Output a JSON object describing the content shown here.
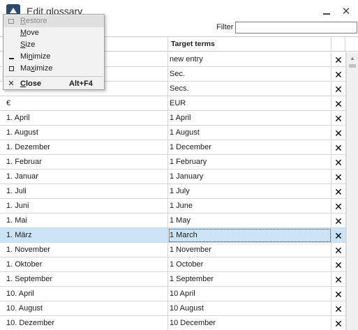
{
  "window": {
    "title": "Edit glossary",
    "close_glyph": "✕",
    "icon": "app-logo-icon"
  },
  "filter": {
    "label": "Filter",
    "value": "",
    "placeholder": ""
  },
  "table": {
    "headers": {
      "source": "",
      "target": "Target terms",
      "delete": ""
    },
    "delete_glyph": "✕",
    "rows": [
      {
        "source": "",
        "target": "new entry"
      },
      {
        "source": "",
        "target": "Sec."
      },
      {
        "source": "",
        "target": "Secs."
      },
      {
        "source": "€",
        "target": "EUR"
      },
      {
        "source": "1. April",
        "target": "1 April"
      },
      {
        "source": "1. August",
        "target": "1 August"
      },
      {
        "source": "1. Dezember",
        "target": "1 December"
      },
      {
        "source": "1. Februar",
        "target": "1 February"
      },
      {
        "source": "1. Januar",
        "target": "1 January"
      },
      {
        "source": "1. Juli",
        "target": "1 July"
      },
      {
        "source": "1. Juni",
        "target": "1 June"
      },
      {
        "source": "1. Mai",
        "target": "1 May"
      },
      {
        "source": "1. März",
        "target": "1 March",
        "selected": true
      },
      {
        "source": "1. November",
        "target": "1 November"
      },
      {
        "source": "1. Oktober",
        "target": "1 October"
      },
      {
        "source": "1. September",
        "target": "1 September"
      },
      {
        "source": "10. April",
        "target": "10 April"
      },
      {
        "source": "10. August",
        "target": "10 August"
      },
      {
        "source": "10. Dezember",
        "target": "10 December"
      }
    ]
  },
  "system_menu": {
    "items": [
      {
        "id": "restore",
        "pre": "",
        "ul": "R",
        "post": "estore",
        "accel": "",
        "disabled": true
      },
      {
        "id": "move",
        "pre": "",
        "ul": "M",
        "post": "ove",
        "accel": ""
      },
      {
        "id": "size",
        "pre": "",
        "ul": "S",
        "post": "ize",
        "accel": ""
      },
      {
        "id": "minimize",
        "pre": "Mi",
        "ul": "n",
        "post": "imize",
        "accel": ""
      },
      {
        "id": "maximize",
        "pre": "Ma",
        "ul": "x",
        "post": "imize",
        "accel": ""
      },
      {
        "id": "close",
        "pre": "",
        "ul": "C",
        "post": "lose",
        "accel": "Alt+F4",
        "bold": true
      }
    ]
  },
  "colors": {
    "selected_row": "#cce4f7",
    "menu_bg": "#f2f2f2",
    "grid_line": "#d5d5d5"
  }
}
